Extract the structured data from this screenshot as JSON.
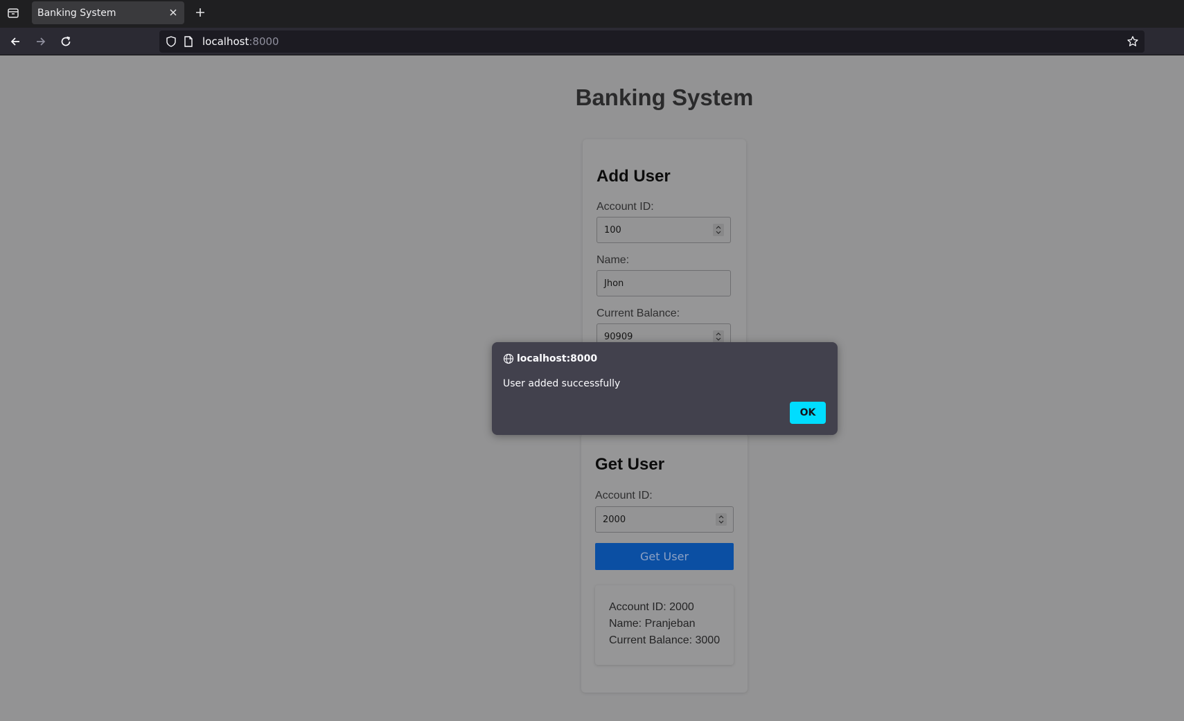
{
  "browser": {
    "tab_title": "Banking System",
    "url_host": "localhost",
    "url_port": ":8000"
  },
  "page": {
    "title": "Banking System"
  },
  "add_user": {
    "heading": "Add User",
    "account_id_label": "Account ID:",
    "account_id_value": "100",
    "name_label": "Name:",
    "name_value": "Jhon",
    "balance_label": "Current Balance:",
    "balance_value": "90909"
  },
  "get_user": {
    "heading": "Get User",
    "account_id_label": "Account ID:",
    "account_id_value": "2000",
    "button_label": "Get User",
    "result": {
      "account_id": "Account ID: 2000",
      "name": "Name: Pranjeban",
      "balance": "Current Balance: 3000"
    }
  },
  "dialog": {
    "origin": "localhost:8000",
    "message": "User added successfully",
    "ok_label": "OK"
  },
  "colors": {
    "dialog_bg": "#42414d",
    "ok_button": "#00ddff",
    "primary_button": "#0b4fa3",
    "overlay_bg": "#939394"
  }
}
